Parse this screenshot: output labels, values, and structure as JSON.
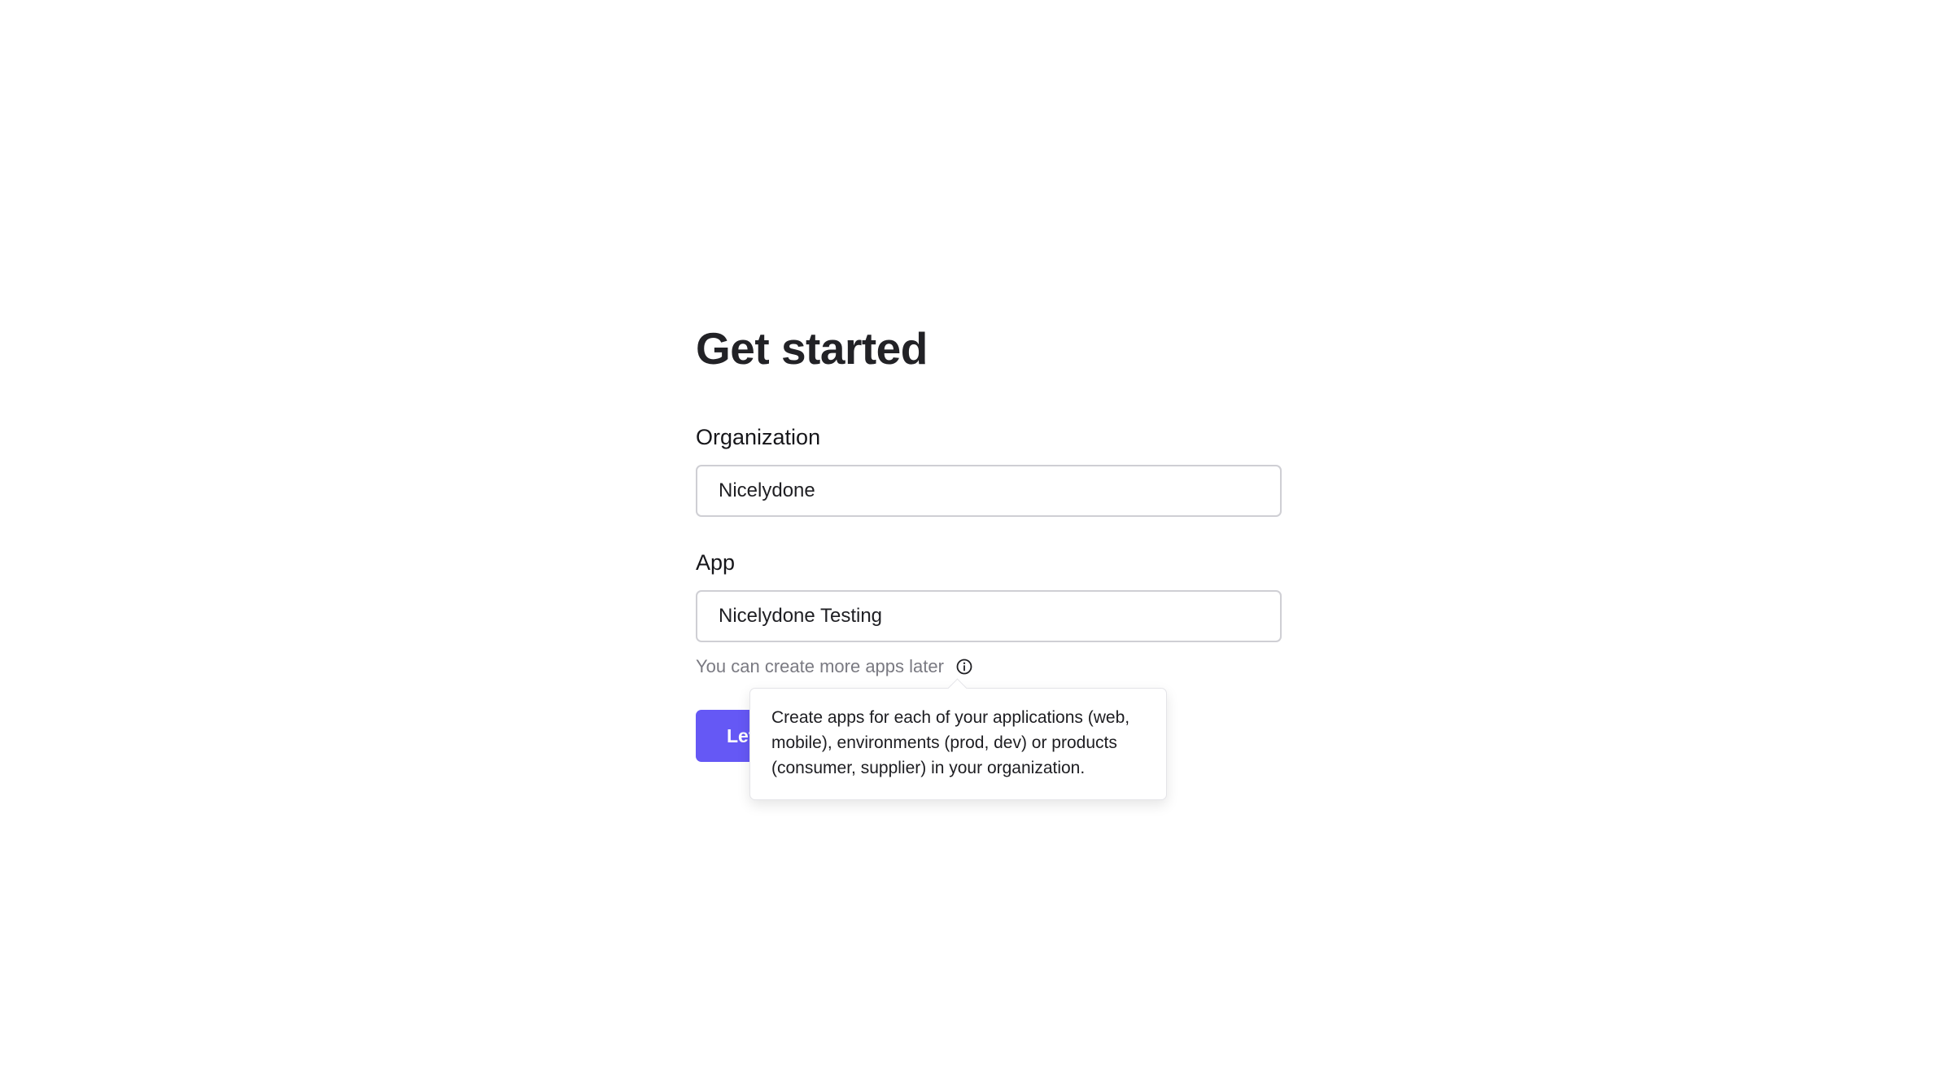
{
  "page": {
    "title": "Get started"
  },
  "form": {
    "organization": {
      "label": "Organization",
      "value": "Nicelydone"
    },
    "app": {
      "label": "App",
      "value": "Nicelydone Testing",
      "hint": "You can create more apps later",
      "hint_icon": "info-circle-icon"
    },
    "submit": {
      "label": "Let's go"
    }
  },
  "tooltip": {
    "text": "Create apps for each of your applications (web, mobile), environments (prod, dev) or products (consumer, supplier) in your organization."
  },
  "colors": {
    "primary": "#6558f5",
    "text": "#1f1f23",
    "muted": "#7a7a82",
    "input_border": "#cfcfd4"
  }
}
